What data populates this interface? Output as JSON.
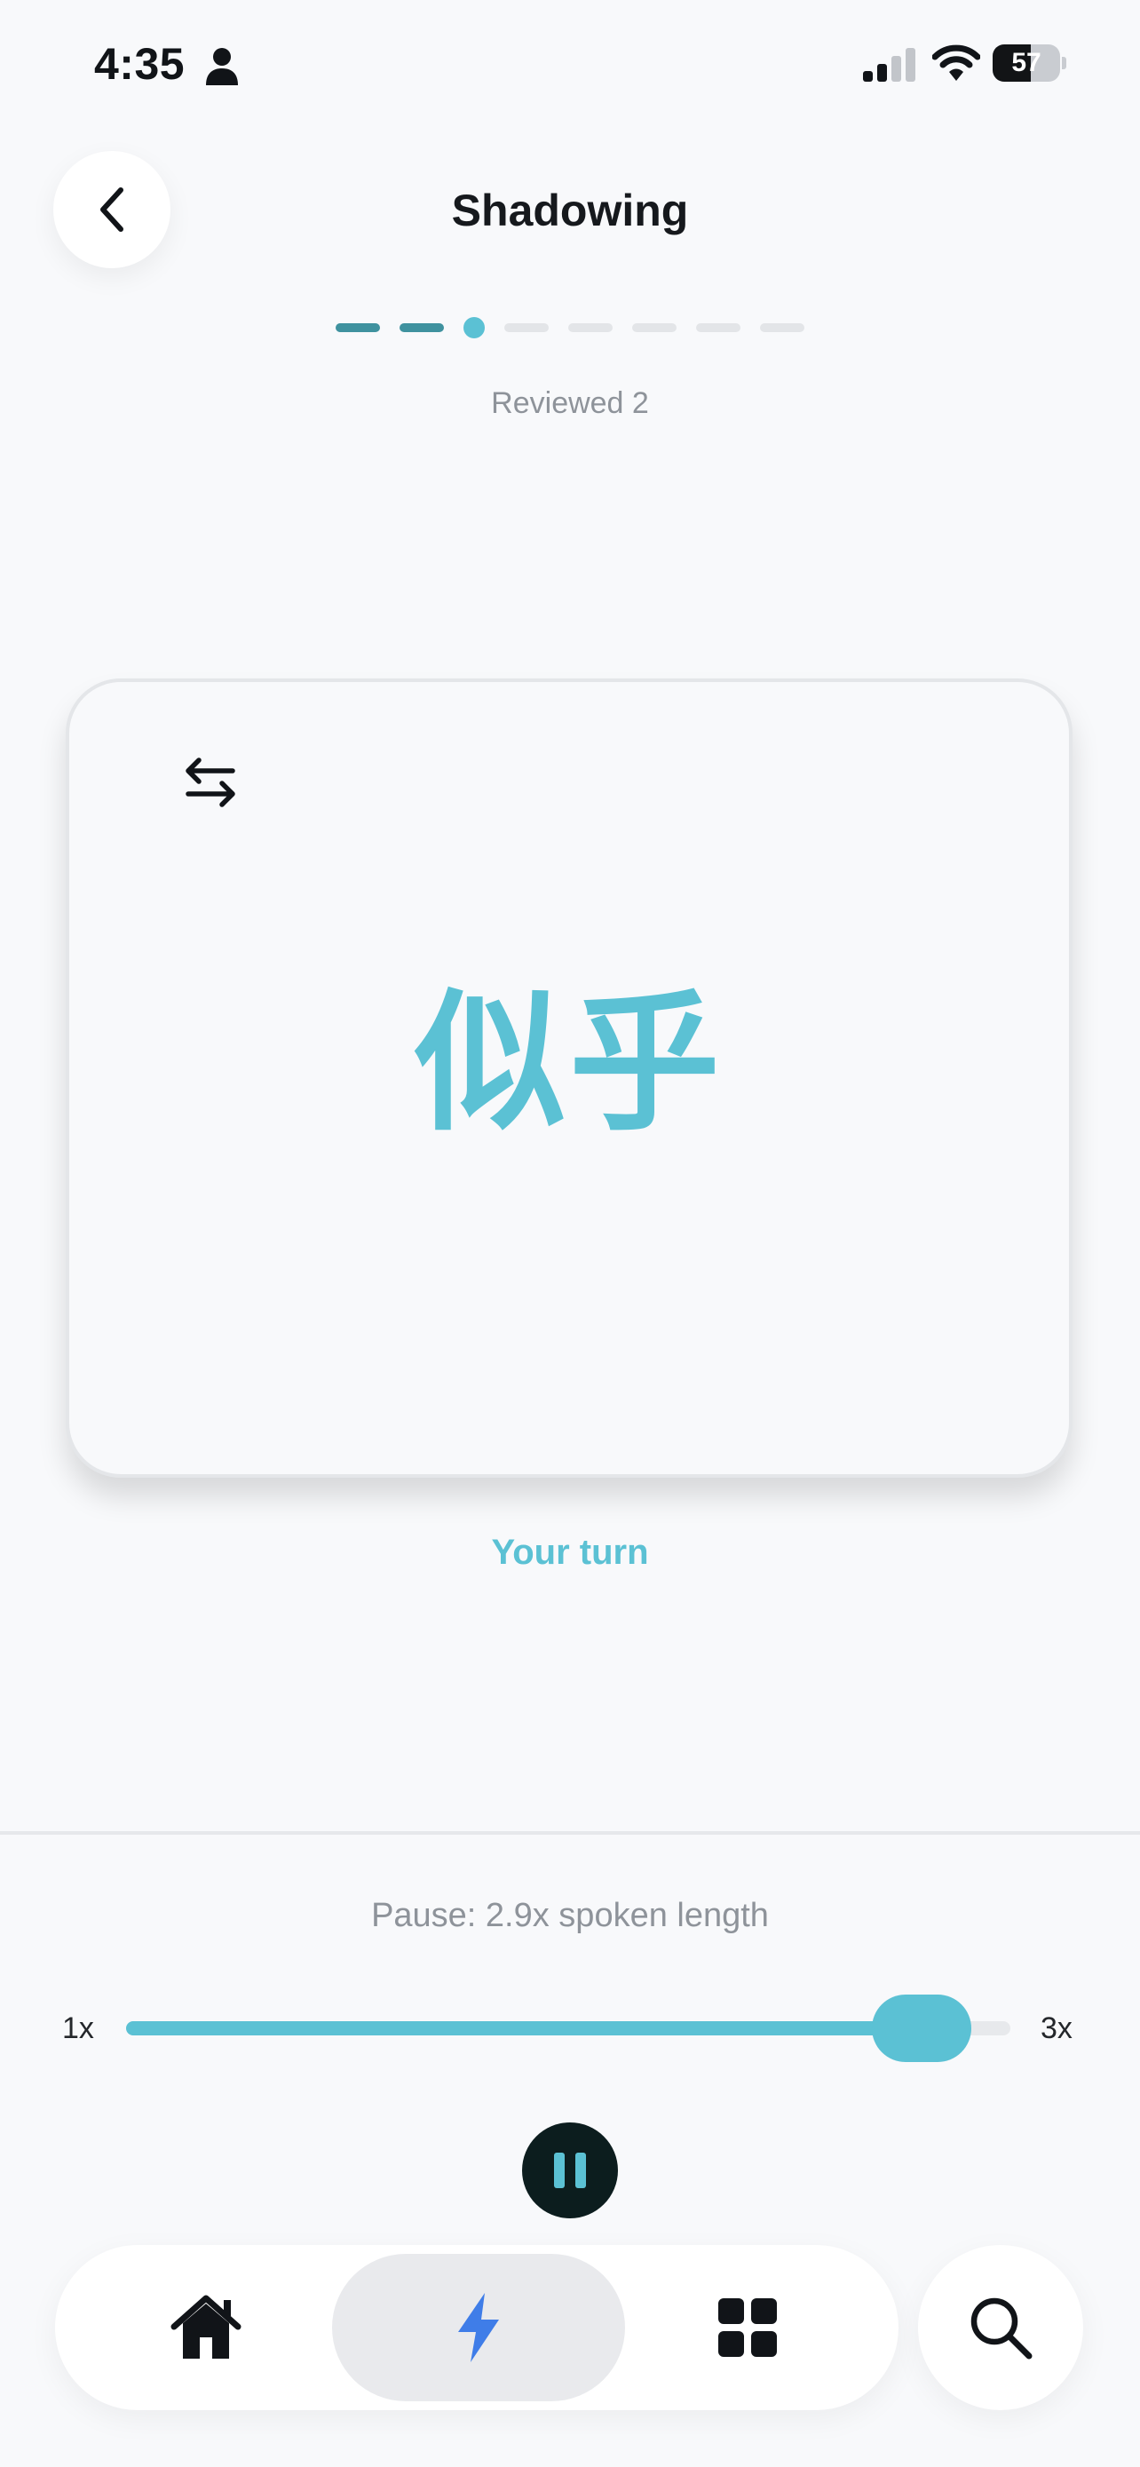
{
  "status_bar": {
    "time": "4:35",
    "battery_level": "57",
    "battery_fraction": 0.57,
    "signal_bars_active": 2,
    "signal_bars_total": 4,
    "icons": [
      "person-icon",
      "signal-icon",
      "wifi-icon",
      "battery-icon"
    ]
  },
  "header": {
    "title": "Shadowing",
    "back_icon": "chevron-left-icon"
  },
  "progress": {
    "total": 8,
    "completed": 2,
    "current": 3,
    "reviewed_text": "Reviewed 2"
  },
  "card": {
    "word": "似乎",
    "swap_icon": "swap-arrows-icon"
  },
  "prompt": {
    "your_turn": "Your turn"
  },
  "speed_control": {
    "pause_text": "Pause: 2.9x spoken length",
    "min_label": "1x",
    "max_label": "3x",
    "min": 1,
    "max": 3,
    "value": 2.9
  },
  "playback": {
    "state": "playing",
    "icon": "pause-icon"
  },
  "bottom_nav": {
    "items": [
      {
        "id": "home",
        "icon": "home-icon",
        "active": false
      },
      {
        "id": "practice",
        "icon": "lightning-icon",
        "active": true
      },
      {
        "id": "apps",
        "icon": "grid-icon",
        "active": false
      }
    ],
    "search_icon": "search-icon"
  },
  "colors": {
    "accent": "#5bc1d4",
    "progress_done": "#3f929f",
    "background": "#f8f9fb",
    "nav_active_icon": "#3f7de8",
    "text_muted": "#8e939a"
  }
}
